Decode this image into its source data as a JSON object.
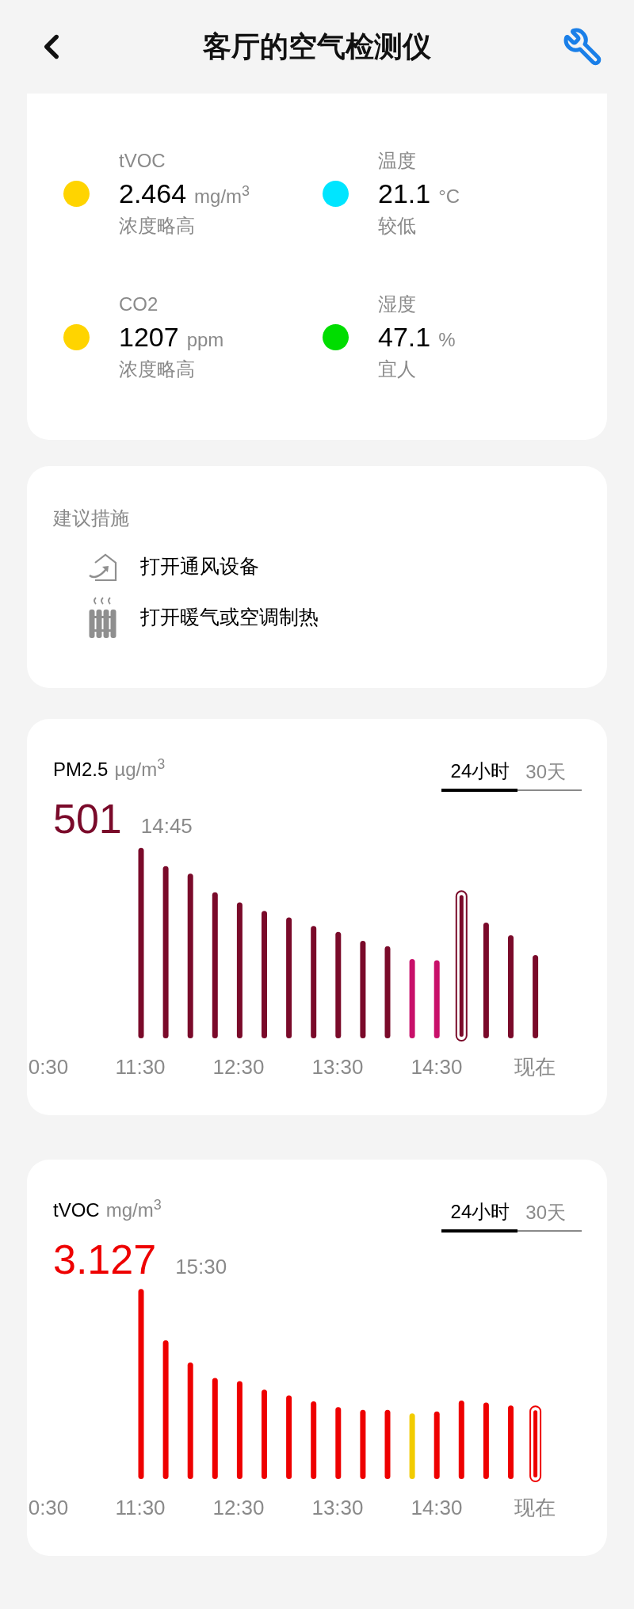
{
  "header": {
    "title": "客厅的空气检测仪"
  },
  "metrics": [
    {
      "label": "tVOC",
      "value": "2.464",
      "unit": "mg/m$^{3}$",
      "status": "浓度略高",
      "color": "#ffd400"
    },
    {
      "label": "温度",
      "value": "21.1",
      "unit": "°C",
      "status": "较低",
      "color": "#00e5ff"
    },
    {
      "label": "CO2",
      "value": "1207",
      "unit": "ppm",
      "status": "浓度略高",
      "color": "#ffd400"
    },
    {
      "label": "湿度",
      "value": "47.1",
      "unit": "%",
      "status": "宜人",
      "color": "#00dd00"
    }
  ],
  "suggestions": {
    "title": "建议措施",
    "items": [
      {
        "kind": "ventilation",
        "text": "打开通风设备"
      },
      {
        "kind": "heating",
        "text": "打开暖气或空调制热"
      }
    ]
  },
  "charts": [
    {
      "kind": "pm",
      "name": "PM2.5",
      "unit": "µg/m$^{3}$",
      "value": "501",
      "time": "14:45",
      "tabs": [
        {
          "label": "24小时",
          "selected": true
        },
        {
          "label": "30天",
          "selected": false
        }
      ],
      "x_labels": [
        "0:30",
        "11:30",
        "12:30",
        "13:30",
        "14:30",
        "现在"
      ]
    },
    {
      "kind": "tvoc",
      "name": "tVOC",
      "unit": "mg/m$^{3}$",
      "value": "3.127",
      "time": "15:30",
      "tabs": [
        {
          "label": "24小时",
          "selected": true
        },
        {
          "label": "30天",
          "selected": false
        }
      ],
      "x_labels": [
        "0:30",
        "11:30",
        "12:30",
        "13:30",
        "14:30",
        "现在"
      ]
    }
  ]
}
